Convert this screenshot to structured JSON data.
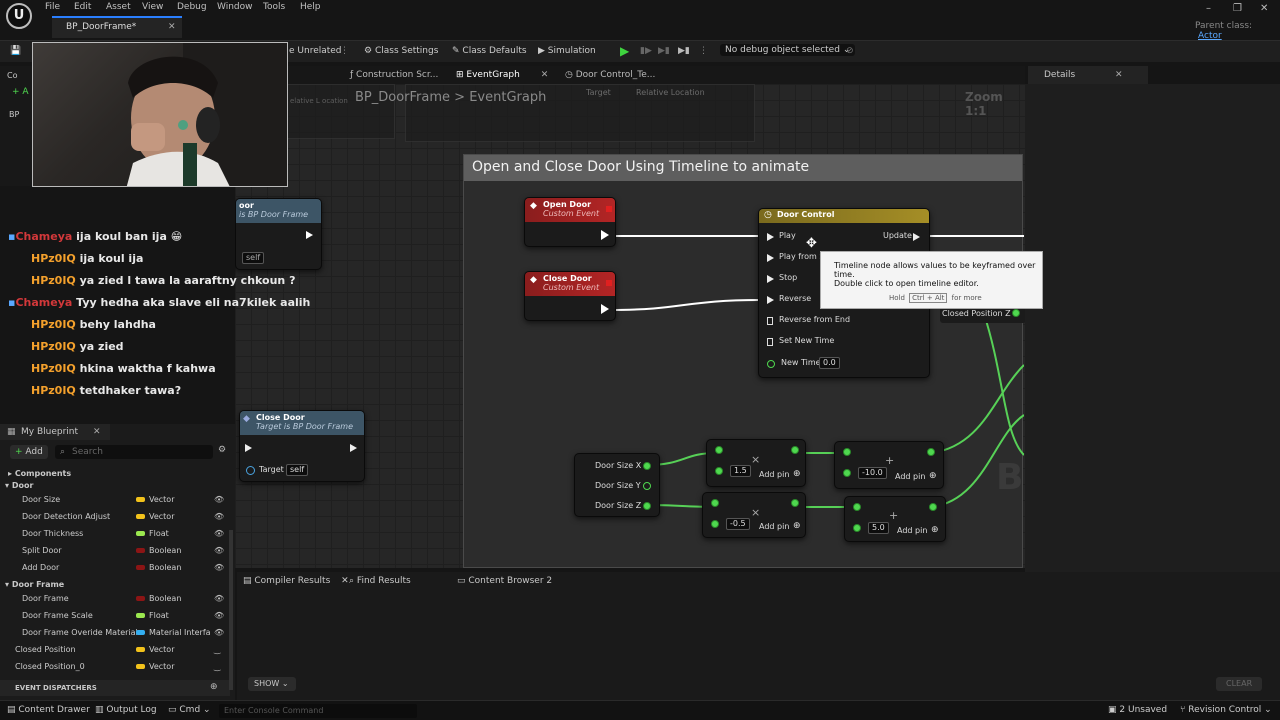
{
  "menu": [
    "File",
    "Edit",
    "Asset",
    "View",
    "Debug",
    "Window",
    "Tools",
    "Help"
  ],
  "doc_tab": "BP_DoorFrame*",
  "parent_class_label": "Parent class:",
  "parent_class_value": "Actor",
  "toolbar": {
    "hide_unrelated": "e Unrelated",
    "class_settings": "Class Settings",
    "class_defaults": "Class Defaults",
    "simulation": "Simulation",
    "debug_select": "No debug object selected"
  },
  "graph_tabs": [
    "Construction Scr...",
    "EventGraph",
    "Door Control_Te..."
  ],
  "breadcrumb": {
    "bp": "BP_DoorFrame",
    "sep": ">",
    "graph": "EventGraph"
  },
  "zoom": "Zoom 1:1",
  "ghost_pins": {
    "target": "Target",
    "relative_location": "Relative Location",
    "relative_l": "elative L ocation"
  },
  "comment_title": "Open and Close Door Using Timeline to animate",
  "nodes": {
    "open_door": {
      "title": "Open Door",
      "subtitle": "Custom Event"
    },
    "close_door_event": {
      "title": "Close Door",
      "subtitle": "Custom Event"
    },
    "door_control": {
      "title": "Door Control",
      "pins_in": [
        "Play",
        "Play from S",
        "Stop",
        "Reverse",
        "Reverse from End",
        "Set New Time",
        "New Time"
      ],
      "new_time": "0.0",
      "update": "Update",
      "closed_position": "Closed Position Z"
    },
    "left_call_1": {
      "title": "oor",
      "subtitle": "is BP Door Frame",
      "self": "self"
    },
    "close_door_call": {
      "title": "Close Door",
      "subtitle": "Target is BP Door Frame",
      "target": "Target",
      "self": "self"
    },
    "break_vec": {
      "x": "Door Size X",
      "y": "Door Size Y",
      "z": "Door Size Z"
    },
    "mult1": {
      "value": "1.5",
      "add_pin": "Add pin"
    },
    "add1": {
      "value": "-10.0",
      "add_pin": "Add pin"
    },
    "mult2": {
      "value": "-0.5",
      "add_pin": "Add pin"
    },
    "add2": {
      "value": "5.0",
      "add_pin": "Add pin"
    }
  },
  "tooltip": {
    "line1": "Timeline node allows values to be keyframed over time.",
    "line2": "Double click to open timeline editor.",
    "hold": "Hold",
    "keys": "Ctrl + Alt",
    "more": "for more"
  },
  "watermark": "BLUEPRINT",
  "details_tab": "Details",
  "chat": [
    {
      "name": "Chameya",
      "msg": "ija koul ban ija 😁",
      "color": "ch"
    },
    {
      "name": "HPz0IQ",
      "msg": "ija koul ija",
      "color": "hp"
    },
    {
      "name": "HPz0IQ",
      "msg": "ya zied l tawa la aaraftny chkoun ?",
      "color": "hp"
    },
    {
      "name": "Chameya",
      "msg": "Tyy hedha aka slave eli na7kilek aalih",
      "color": "ch"
    },
    {
      "name": "HPz0IQ",
      "msg": "behy lahdha",
      "color": "hp"
    },
    {
      "name": "HPz0IQ",
      "msg": "ya zied",
      "color": "hp"
    },
    {
      "name": "HPz0IQ",
      "msg": "hkina waktha f kahwa",
      "color": "hp"
    },
    {
      "name": "HPz0IQ",
      "msg": "tetdhaker tawa?",
      "color": "hp"
    }
  ],
  "left_partial": {
    "co": "Co",
    "a": "A",
    "bp": "BP"
  },
  "my_blueprint": {
    "title": "My Blueprint",
    "add": "Add",
    "search_placeholder": "Search",
    "components": "Components",
    "cat_door": "Door",
    "cat_door_frame": "Door Frame",
    "event_dispatchers": "EVENT DISPATCHERS"
  },
  "variables": [
    {
      "name": "Door Size",
      "type": "Vector",
      "color": "#f2c21b"
    },
    {
      "name": "Door Detection Adjust",
      "type": "Vector",
      "color": "#f2c21b"
    },
    {
      "name": "Door Thickness",
      "type": "Float",
      "color": "#9be84f"
    },
    {
      "name": "Split Door",
      "type": "Boolean",
      "color": "#8c1515"
    },
    {
      "name": "Add Door",
      "type": "Boolean",
      "color": "#8c1515"
    },
    {
      "name": "Door Frame",
      "type": "Boolean",
      "color": "#8c1515"
    },
    {
      "name": "Door Frame Scale",
      "type": "Float",
      "color": "#9be84f"
    },
    {
      "name": "Door Frame Overide Material",
      "type": "Material Interfa",
      "color": "#33aef0"
    },
    {
      "name": "Closed Position",
      "type": "Vector",
      "color": "#f2c21b"
    },
    {
      "name": "Closed Position_0",
      "type": "Vector",
      "color": "#f2c21b"
    }
  ],
  "bottom_tabs": [
    "Compiler Results",
    "Find Results",
    "Content Browser 2"
  ],
  "show_btn": "SHOW",
  "clear_btn": "CLEAR",
  "status": {
    "content_drawer": "Content Drawer",
    "output_log": "Output Log",
    "cmd": "Cmd",
    "console_placeholder": "Enter Console Command",
    "unsaved": "2 Unsaved",
    "revision": "Revision Control"
  }
}
